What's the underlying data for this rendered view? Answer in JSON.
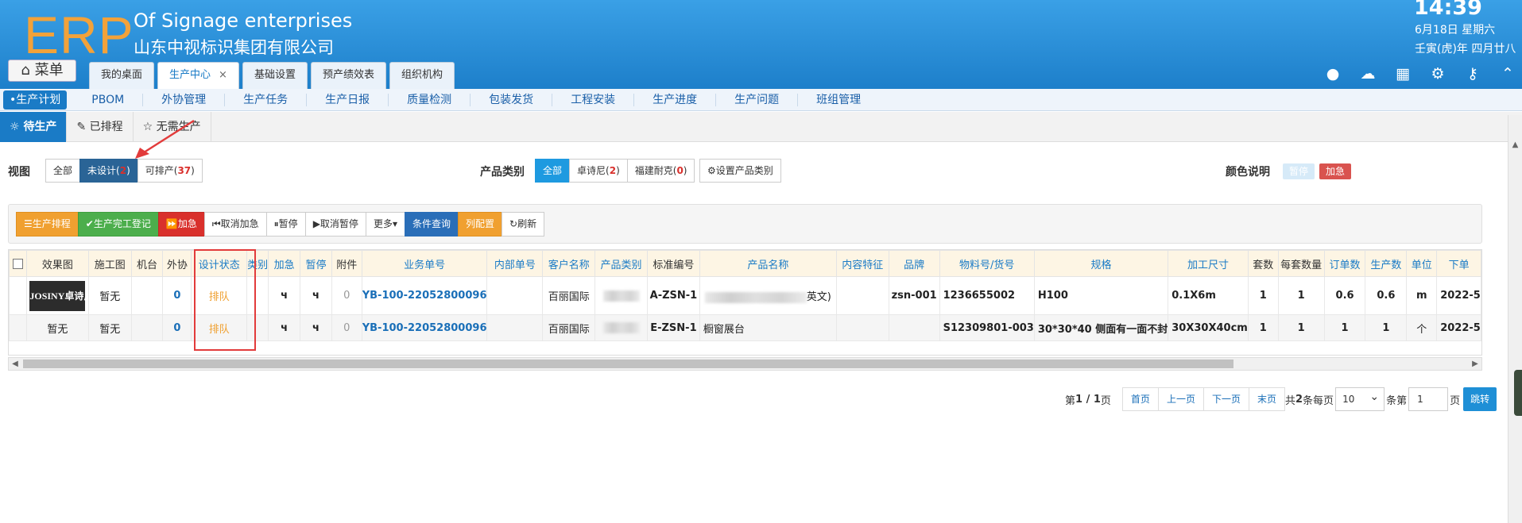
{
  "header": {
    "logo": "ERP",
    "company_en": "Of Signage enterprises",
    "company_cn": "山东中视标识集团有限公司",
    "clock": "14:39",
    "date": "6月18日 星期六",
    "lunar": "壬寅(虎)年 四月廿八",
    "menu_label": "菜单",
    "tabs": [
      {
        "label": "我的桌面"
      },
      {
        "label": "生产中心",
        "close": "×"
      },
      {
        "label": "基础设置"
      },
      {
        "label": "预产绩效表"
      },
      {
        "label": "组织机构"
      }
    ]
  },
  "subnav": [
    "•生产计划",
    "PBOM",
    "外协管理",
    "生产任务",
    "生产日报",
    "质量检测",
    "包装发货",
    "工程安装",
    "生产进度",
    "生产问题",
    "班组管理"
  ],
  "status_tabs": [
    "待生产",
    "已排程",
    "无需生产"
  ],
  "filter": {
    "view_label": "视图",
    "view_all": "全部",
    "view_undesigned": "未设计(",
    "view_undesigned_count": "2",
    "view_undesigned_close": ")",
    "view_schedulable": "可排产(",
    "view_schedulable_count": "37",
    "view_schedulable_close": ")",
    "category_label": "产品类别",
    "cat_all": "全部",
    "cat_1": "卓诗尼(",
    "cat_1_count": "2",
    "cat_1_close": ")",
    "cat_2": "福建耐克(",
    "cat_2_count": "0",
    "cat_2_close": ")",
    "set_category": "设置产品类别",
    "color_label": "颜色说明",
    "legend_pause": "暂停",
    "legend_urgent": "加急"
  },
  "toolbar": [
    "生产排程",
    "生产完工登记",
    "加急",
    "取消加急",
    "暂停",
    "取消暂停",
    "更多",
    "条件查询",
    "列配置",
    "刷新"
  ],
  "table": {
    "headers": [
      "效果图",
      "施工图",
      "机台",
      "外协",
      "设计状态",
      "类别",
      "加急",
      "暂停",
      "附件",
      "业务单号",
      "内部单号",
      "客户名称",
      "产品类别",
      "标准编号",
      "产品名称",
      "内容特征",
      "品牌",
      "物料号/货号",
      "规格",
      "加工尺寸",
      "套数",
      "每套数量",
      "订单数",
      "生产数",
      "单位",
      "下单"
    ],
    "rows": [
      {
        "effect": "JOSINY卓诗尼",
        "construction": "暂无",
        "machine": "",
        "outsource": "0",
        "design_status": "排队",
        "category": "",
        "urgent": "ч",
        "pause": "ч",
        "attach": "0",
        "order_no": "YB-100-22052800096",
        "internal_no": "",
        "customer": "百丽国际",
        "product_cat": "",
        "std_no": "A-ZSN-1",
        "product_name_tail": "英文)",
        "content": "",
        "brand": "zsn-001",
        "material": "1236655002",
        "spec": "H100",
        "size": "0.1X6m",
        "sets": "1",
        "per_set": "1",
        "order_qty": "0.6",
        "prod_qty": "0.6",
        "unit": "m",
        "order_date": "2022-5"
      },
      {
        "effect": "暂无",
        "construction": "暂无",
        "machine": "",
        "outsource": "0",
        "design_status": "排队",
        "category": "",
        "urgent": "ч",
        "pause": "ч",
        "attach": "0",
        "order_no": "YB-100-22052800096",
        "internal_no": "",
        "customer": "百丽国际",
        "product_cat": "",
        "std_no": "E-ZSN-1",
        "product_name": "橱窗展台",
        "content": "",
        "brand": "",
        "material": "S12309801-003",
        "spec": "30*30*40 侧面有一面不封",
        "size": "30X30X40cm",
        "sets": "1",
        "per_set": "1",
        "order_qty": "1",
        "prod_qty": "1",
        "unit": "个",
        "order_date": "2022-5"
      }
    ]
  },
  "pager": {
    "page_prefix": "第",
    "page_info": "1 / 1",
    "page_suffix": "页",
    "first": "首页",
    "prev": "上一页",
    "next": "下一页",
    "last": "末页",
    "total_prefix": "共",
    "total": "2",
    "total_suffix": "条每页",
    "per_page": "10",
    "goto_suffix": "条第",
    "goto_value": "1",
    "page_unit": "页",
    "go": "跳转"
  },
  "icons": {
    "menu": "home-icon",
    "tools": [
      "user-icon",
      "cloud-icon",
      "add-app-icon",
      "gear-icon",
      "key-icon",
      "collapse-icon"
    ]
  },
  "colors": {
    "header": "#1d7fca",
    "accent": "#1a7bc6",
    "orange": "#f0a030",
    "red": "#d9302c",
    "green": "#4cae4c"
  }
}
